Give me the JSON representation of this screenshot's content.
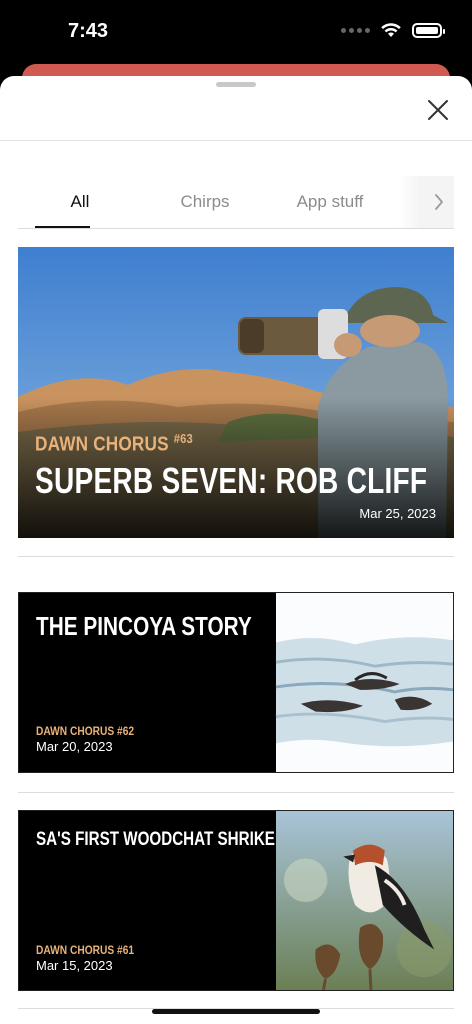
{
  "status_bar": {
    "time": "7:43"
  },
  "tabs": [
    {
      "label": "All",
      "active": true
    },
    {
      "label": "Chirps",
      "active": false
    },
    {
      "label": "App stuff",
      "active": false
    }
  ],
  "featured": {
    "series": "DAWN CHORUS",
    "number": "#63",
    "title": "SUPERB SEVEN: ROB CLIFF",
    "date": "Mar 25, 2023"
  },
  "articles": [
    {
      "title": "THE PINCOYA STORY",
      "series": "DAWN CHORUS #62",
      "date": "Mar 20, 2023"
    },
    {
      "title": "SA'S FIRST WOODCHAT SHRIKE!",
      "series": "DAWN CHORUS #61",
      "date": "Mar 15, 2023"
    }
  ],
  "colors": {
    "accent": "#e8b27a",
    "under_sheet": "#d05a52"
  },
  "icons": [
    "wifi-icon",
    "battery-icon",
    "close-icon",
    "chevron-right-icon"
  ]
}
